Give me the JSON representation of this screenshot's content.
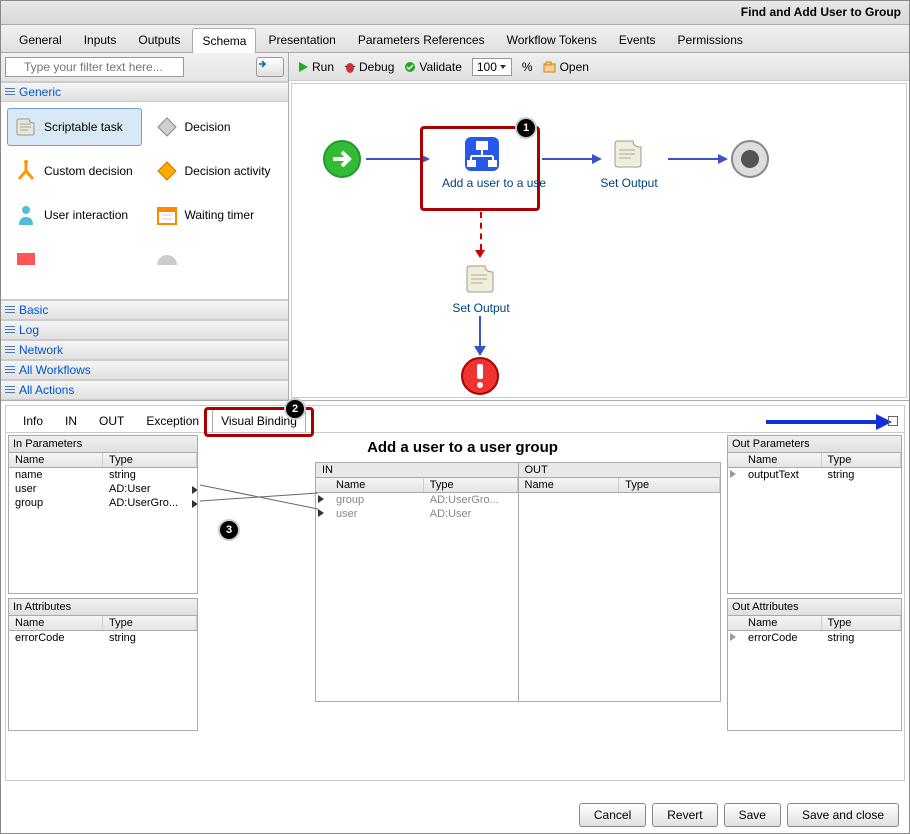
{
  "title": "Find and Add User to Group",
  "mainTabs": [
    "General",
    "Inputs",
    "Outputs",
    "Schema",
    "Presentation",
    "Parameters References",
    "Workflow Tokens",
    "Events",
    "Permissions"
  ],
  "activeMainTab": "Schema",
  "search": {
    "placeholder": "Type your filter text here..."
  },
  "palette": {
    "topCategory": "Generic",
    "tools": [
      {
        "label": "Scriptable task",
        "icon": "script"
      },
      {
        "label": "Decision",
        "icon": "diamond"
      },
      {
        "label": "Custom decision",
        "icon": "fork"
      },
      {
        "label": "Decision activity",
        "icon": "diamond-orange"
      },
      {
        "label": "User interaction",
        "icon": "person"
      },
      {
        "label": "Waiting timer",
        "icon": "calendar"
      }
    ],
    "categories": [
      "Basic",
      "Log",
      "Network",
      "All Workflows",
      "All Actions"
    ]
  },
  "canvasToolbar": {
    "run": "Run",
    "debug": "Debug",
    "validate": "Validate",
    "zoom": "100",
    "pct": "%",
    "open": "Open"
  },
  "nodes": {
    "addUser": "Add a user to a use",
    "setOutput1": "Set Output",
    "setOutput2": "Set Output"
  },
  "subTabs": [
    "Info",
    "IN",
    "OUT",
    "Exception",
    "Visual Binding"
  ],
  "activeSubTab": "Visual Binding",
  "binding": {
    "title": "Add a user to a user group",
    "inParamsTitle": "In Parameters",
    "inAttrsTitle": "In Attributes",
    "outParamsTitle": "Out Parameters",
    "outAttrsTitle": "Out Attributes",
    "nameHdr": "Name",
    "typeHdr": "Type",
    "inLabel": "IN",
    "outLabel": "OUT",
    "inParams": [
      {
        "name": "name",
        "type": "string"
      },
      {
        "name": "user",
        "type": "AD:User"
      },
      {
        "name": "group",
        "type": "AD:UserGro..."
      }
    ],
    "inAttrs": [
      {
        "name": "errorCode",
        "type": "string"
      }
    ],
    "outParams": [
      {
        "name": "outputText",
        "type": "string"
      }
    ],
    "outAttrs": [
      {
        "name": "errorCode",
        "type": "string"
      }
    ],
    "centerIn": [
      {
        "name": "group",
        "type": "AD:UserGro..."
      },
      {
        "name": "user",
        "type": "AD:User"
      }
    ]
  },
  "buttons": {
    "cancel": "Cancel",
    "revert": "Revert",
    "save": "Save",
    "saveClose": "Save and close"
  }
}
